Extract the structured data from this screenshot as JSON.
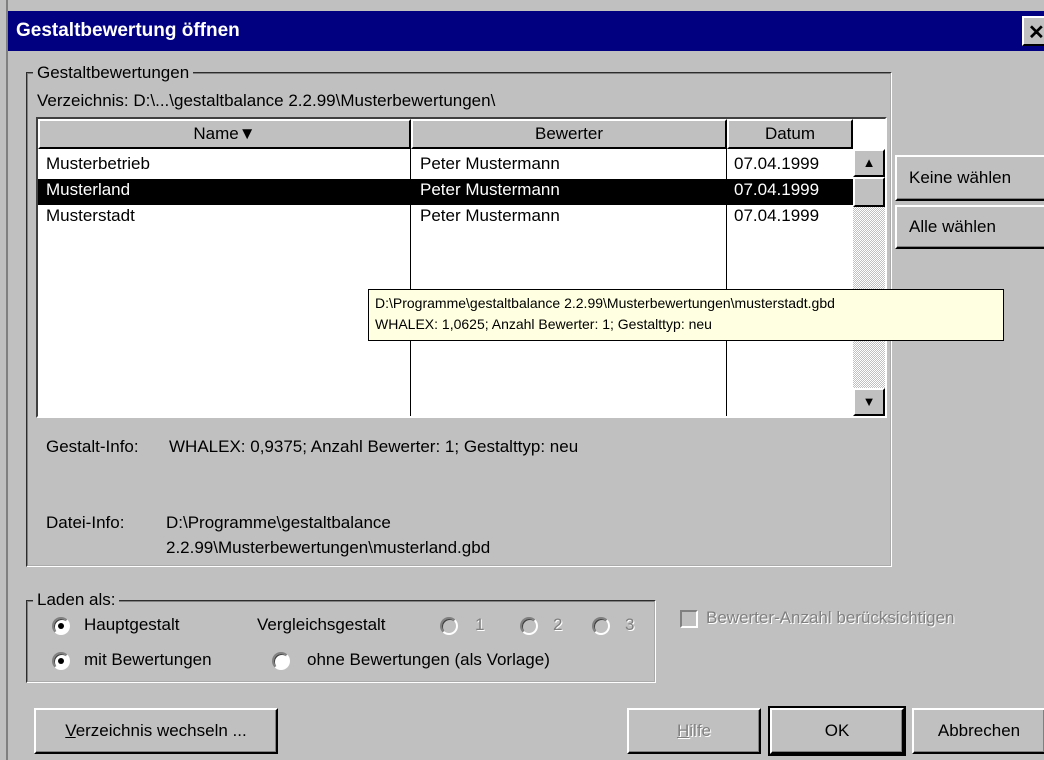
{
  "window": {
    "title": "Gestaltbewertung öffnen",
    "close_glyph": "✕"
  },
  "group_bewertungen": {
    "legend": "Gestaltbewertungen",
    "directory": "Verzeichnis: D:\\...\\gestaltbalance 2.2.99\\Musterbewertungen\\"
  },
  "list": {
    "columns": [
      "Name▼",
      "Bewerter",
      "Datum"
    ],
    "rows": [
      {
        "name": "Musterbetrieb",
        "bewerter": "Peter Mustermann",
        "datum": "07.04.1999",
        "selected": false
      },
      {
        "name": "Musterland",
        "bewerter": "Peter Mustermann",
        "datum": "07.04.1999",
        "selected": true
      },
      {
        "name": "Musterstadt",
        "bewerter": "Peter Mustermann",
        "datum": "07.04.1999",
        "selected": false
      }
    ]
  },
  "tooltip": {
    "line1": "D:\\Programme\\gestaltbalance 2.2.99\\Musterbewertungen\\musterstadt.gbd",
    "line2": "WHALEX: 1,0625; Anzahl Bewerter: 1; Gestalttyp: neu"
  },
  "info": {
    "gestalt_label": "Gestalt-Info:",
    "gestalt_value": "WHALEX: 0,9375; Anzahl Bewerter: 1; Gestalttyp: neu",
    "datei_label": "Datei-Info:",
    "datei_line1": "D:\\Programme\\gestaltbalance",
    "datei_line2": "2.2.99\\Musterbewertungen\\musterland.gbd"
  },
  "side_buttons": {
    "keine": "Keine wählen",
    "alle": "Alle wählen"
  },
  "laden": {
    "legend": "Laden als:",
    "haupt": "Hauptgestalt",
    "vergleich": "Vergleichsgestalt",
    "v1": "1",
    "v2": "2",
    "v3": "3",
    "mit": "mit Bewertungen",
    "ohne": "ohne Bewertungen (als Vorlage)"
  },
  "checkbox": {
    "label": "Bewerter-Anzahl berücksichtigen",
    "checked": false,
    "enabled": false
  },
  "buttons": {
    "verzeichnis_u": "V",
    "verzeichnis_rest": "erzeichnis wechseln ...",
    "hilfe_u": "H",
    "hilfe_rest": "ilfe",
    "ok": "OK",
    "abbrechen": "Abbrechen"
  }
}
